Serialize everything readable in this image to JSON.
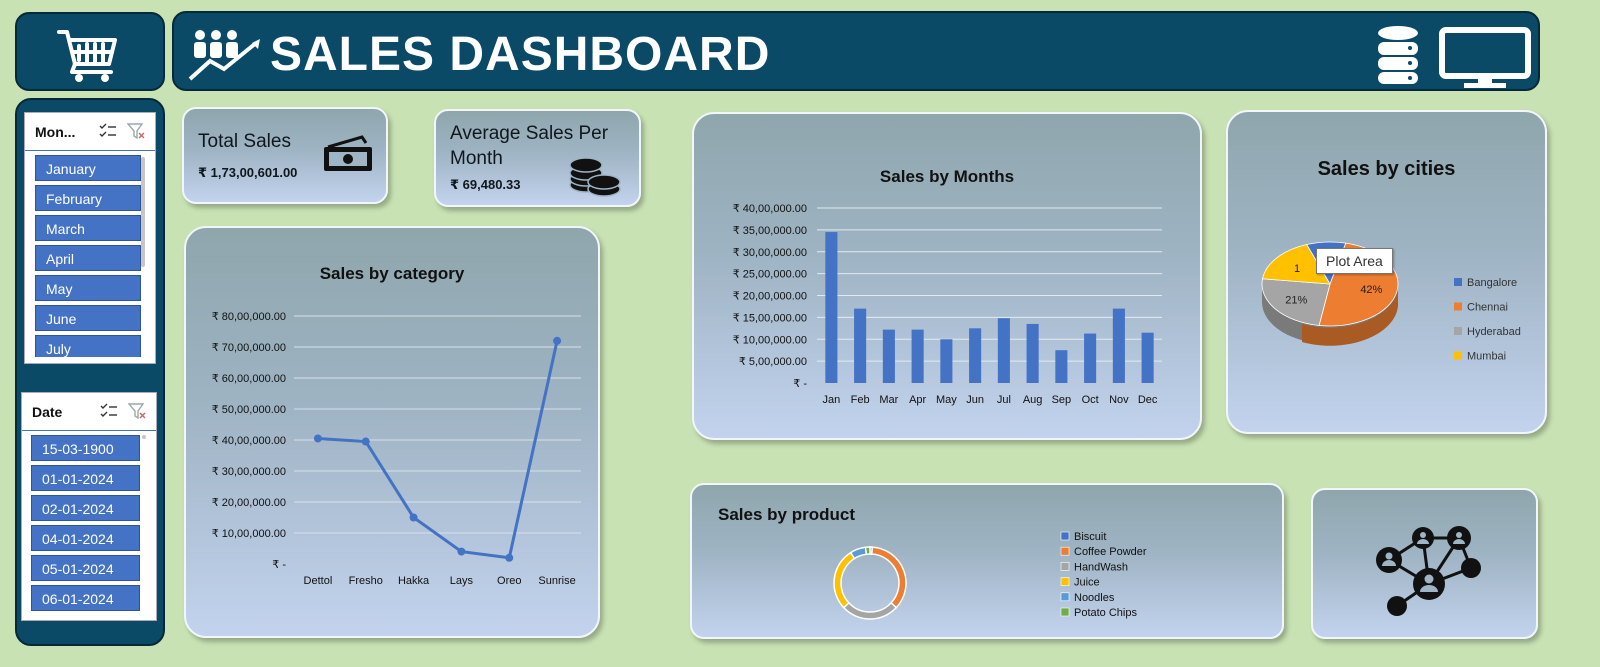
{
  "header": {
    "title": "SALES DASHBOARD"
  },
  "kpis": {
    "total_sales": {
      "label": "Total Sales",
      "value": "₹ 1,73,00,601.00"
    },
    "avg_sales": {
      "label_line1": "Average Sales Per",
      "label_line2": "Month",
      "value": "₹  69,480.33"
    }
  },
  "slicer_month": {
    "title": "Mon...",
    "items": [
      "January",
      "February",
      "March",
      "April",
      "May",
      "June",
      "July"
    ]
  },
  "slicer_date": {
    "title": "Date",
    "items": [
      "15-03-1900",
      "01-01-2024",
      "02-01-2024",
      "04-01-2024",
      "05-01-2024",
      "06-01-2024"
    ]
  },
  "colors": {
    "bar": "#4472c4",
    "line": "#4472c4",
    "bangalore": "#4472c4",
    "chennai": "#ed7d31",
    "hyderabad": "#a5a5a5",
    "mumbai": "#ffc000",
    "noodles": "#5b9bd5",
    "potato_chips": "#70ad47"
  },
  "tooltip": "Plot Area",
  "chart_data": [
    {
      "id": "category",
      "type": "line",
      "title": "Sales by category",
      "categories": [
        "Dettol",
        "Fresho",
        "Hakka",
        "Lays",
        "Oreo",
        "Sunrise"
      ],
      "values": [
        4050000,
        3950000,
        1500000,
        400000,
        200000,
        7200000
      ],
      "ylim": [
        0,
        8000000
      ],
      "yticks": [
        "₹ 80,00,000.00",
        "₹ 70,00,000.00",
        "₹ 60,00,000.00",
        "₹ 50,00,000.00",
        "₹ 40,00,000.00",
        "₹ 30,00,000.00",
        "₹ 20,00,000.00",
        "₹ 10,00,000.00",
        "₹ -"
      ]
    },
    {
      "id": "months",
      "type": "bar",
      "title": "Sales by Months",
      "categories": [
        "Jan",
        "Feb",
        "Mar",
        "Apr",
        "May",
        "Jun",
        "Jul",
        "Aug",
        "Sep",
        "Oct",
        "Nov",
        "Dec"
      ],
      "values": [
        3450000,
        1700000,
        1220000,
        1220000,
        1000000,
        1250000,
        1480000,
        1350000,
        750000,
        1130000,
        1700000,
        1150000
      ],
      "ylim": [
        0,
        4000000
      ],
      "yticks": [
        "₹ 40,00,000.00",
        "₹ 35,00,000.00",
        "₹ 30,00,000.00",
        "₹ 25,00,000.00",
        "₹ 20,00,000.00",
        "₹ 15,00,000.00",
        "₹ 10,00,000.00",
        "₹ 5,00,000.00",
        "₹ -"
      ]
    },
    {
      "id": "cities",
      "type": "pie",
      "title": "Sales by cities",
      "labels": [
        "Bangalore",
        "Chennai",
        "Hyderabad",
        "Mumbai"
      ],
      "values": [
        8,
        42,
        21,
        15
      ],
      "data_labels": [
        "",
        "42%",
        "21%",
        "1"
      ]
    },
    {
      "id": "product",
      "type": "pie",
      "title": "Sales by product",
      "labels": [
        "Biscuit",
        "Coffee Powder",
        "HandWash",
        "Juice",
        "Noodles",
        "Potato Chips"
      ],
      "values": [
        1,
        36,
        26,
        28,
        7,
        2
      ]
    }
  ]
}
